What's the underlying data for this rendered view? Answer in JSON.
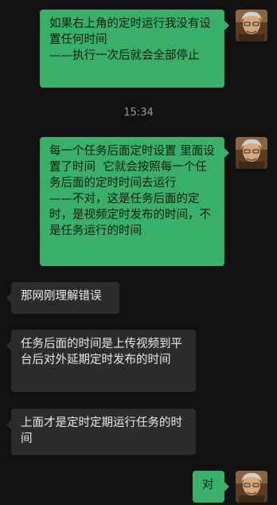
{
  "messages": [
    {
      "side": "out",
      "text": "如果右上角的定时运行我没有设置任何时间\n——执行一次后就会全部停止"
    },
    {
      "side": "out",
      "text": "每一个任务后面定时设置 里面设置了时间  它就会按照每一个任务后面的定时时间去运行\n——不对，这是任务后面的定时，是视频定时发布的时间，不是任务运行的时间"
    },
    {
      "side": "in",
      "text": "那网刚理解错误"
    },
    {
      "side": "in",
      "text": "任务后面的时间是上传视频到平台后对外延期定时发布的时间"
    },
    {
      "side": "in",
      "text": "上面才是定时定期运行任务的时间"
    },
    {
      "side": "out",
      "text": "对"
    }
  ],
  "timestamp": "15:34",
  "colors": {
    "outgoing_bubble": "#39b06a",
    "incoming_bubble": "#2c2c2c",
    "background": "#111111"
  },
  "avatar_icon": "user-avatar-icon"
}
